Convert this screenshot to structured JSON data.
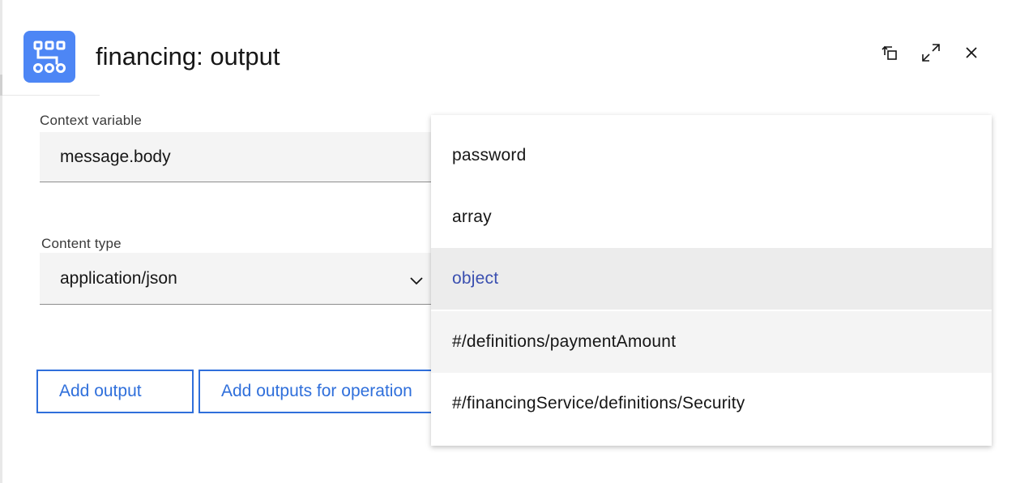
{
  "header": {
    "title": "financing: output",
    "app_icon": "flow-nodes-icon",
    "actions": [
      {
        "name": "restore-icon"
      },
      {
        "name": "maximize-icon"
      },
      {
        "name": "close-icon"
      }
    ]
  },
  "form": {
    "context_variable": {
      "label": "Context variable",
      "value": "message.body"
    },
    "content_type": {
      "label": "Content type",
      "value": "application/json"
    },
    "buttons": {
      "add_output": "Add output",
      "add_outputs_for_operation": "Add outputs for operation"
    }
  },
  "dropdown": {
    "items": [
      {
        "label": "password",
        "state": "normal"
      },
      {
        "label": "array",
        "state": "normal"
      },
      {
        "label": "object",
        "state": "selected"
      },
      {
        "label": "#/definitions/paymentAmount",
        "state": "hovered"
      },
      {
        "label": "#/financingService/definitions/Security",
        "state": "normal"
      }
    ]
  },
  "colors": {
    "accent": "#4d86f5",
    "button_blue": "#2f6fdb",
    "selected_text": "#3a4fb0",
    "field_bg": "#f4f4f4"
  }
}
